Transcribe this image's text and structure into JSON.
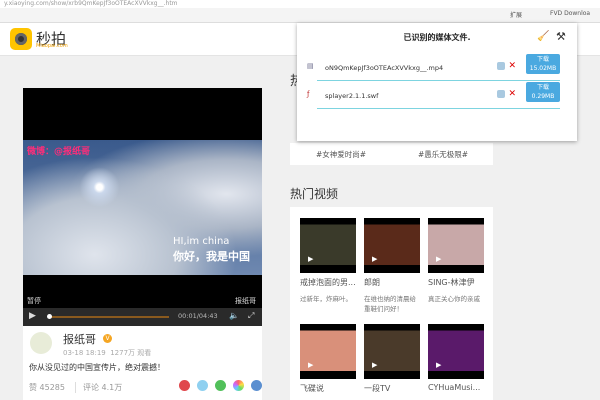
{
  "browser": {
    "address": "y.xiaoying.com/show/xrb9QmKepJf3oOTEAcXVVkxg__.htm",
    "extensions": [
      "扩展",
      "FVD Downloa"
    ]
  },
  "site": {
    "logo_text": "秒拍",
    "logo_sub": "Miaopai.com"
  },
  "video": {
    "watermark": "微博：@报纸哥",
    "caption_en": "HI,im china",
    "caption_cn": "你好，我是中国",
    "pause_label": "暂停",
    "author_watermark": "报纸哥",
    "time": "00:01/04:43",
    "progress": 0.005
  },
  "post": {
    "author": "报纸哥",
    "verified": "V",
    "date": "03-18 18:19",
    "views": "1277万 观看",
    "description": "你从没见过的中国宣传片，绝对震撼！",
    "likes": "赞 45285",
    "comments": "评论 4.1万"
  },
  "sidebar": {
    "hot_topics_heading": "热",
    "tags": [
      "#女神爱时尚#",
      "#愚乐无极限#"
    ],
    "hot_videos_heading": "热门视频",
    "videos": [
      {
        "title": "戒掉泡面的男...",
        "desc": "过新年，炸麻叶。",
        "color": "#3a3a2a"
      },
      {
        "title": "郎朗",
        "desc": "在维也纳的清晨给重鞋们问好！",
        "color": "#5a2a1a"
      },
      {
        "title": "SING-林津伊",
        "desc": "真正关心你的亲戚",
        "color": "#c8a8a8"
      },
      {
        "title": "飞碟说",
        "desc": "",
        "color": "#d9907a"
      },
      {
        "title": "一段TV",
        "desc": "",
        "color": "#4a3a2a"
      },
      {
        "title": "CYHuaMusi...",
        "desc": "",
        "color": "#5a1a6a"
      }
    ]
  },
  "popup": {
    "title": "已识别的媒体文件.",
    "files": [
      {
        "name": "oN9QmKepJf3oOTEAcXVVkxg__.mp4",
        "button_line1": "下载",
        "button_line2": "15.02MB"
      },
      {
        "name": "splayer2.1.1.swf",
        "button_line1": "下载",
        "button_line2": "0.29MB"
      }
    ]
  }
}
